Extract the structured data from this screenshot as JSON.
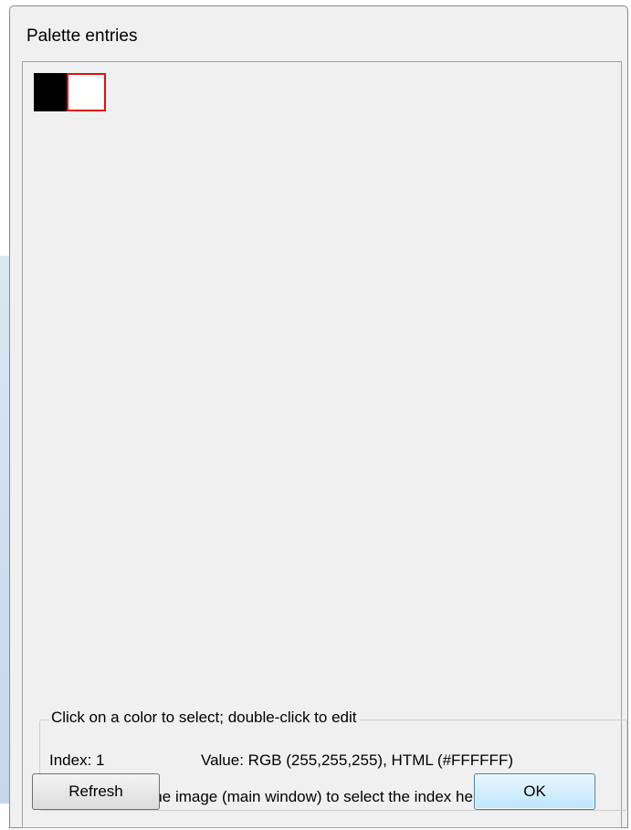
{
  "window": {
    "title": "Palette entries"
  },
  "palette": {
    "swatches": [
      {
        "index": 0,
        "color": "#000000"
      },
      {
        "index": 1,
        "color": "#FFFFFF",
        "selected": true
      }
    ],
    "selection_color": "#E01010"
  },
  "info": {
    "legend": "Click on a color to select; double-click to edit",
    "index_text": "Index: 1",
    "value_text": "Value: RGB (255,255,255), HTML (#FFFFFF)",
    "hint_text": "Hint: click into the image (main window) to select the index here."
  },
  "buttons": {
    "refresh_label": "Refresh",
    "ok_label": "OK"
  }
}
